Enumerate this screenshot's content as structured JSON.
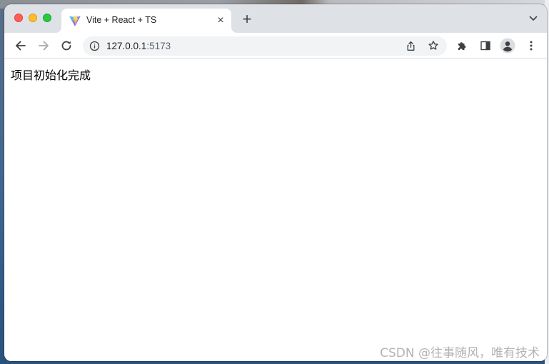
{
  "browser": {
    "tab": {
      "title": "Vite + React + TS"
    },
    "new_tab_label": "+",
    "close_tab_label": "×",
    "address_bar": {
      "host": "127.0.0.1",
      "port": ":5173"
    }
  },
  "page": {
    "body_text": "项目初始化完成"
  },
  "watermark": "CSDN @往事随风，唯有技术",
  "icons": {
    "back": "arrow-left-icon",
    "forward": "arrow-right-icon",
    "reload": "reload-icon",
    "info": "info-icon",
    "share": "share-icon",
    "bookmark": "star-icon",
    "extensions": "puzzle-icon",
    "side_panel": "side-panel-icon",
    "profile": "avatar-icon",
    "menu": "kebab-menu-icon",
    "tab_search": "chevron-down-icon",
    "favicon": "vite-logo-icon"
  },
  "colors": {
    "tabstrip": "#dee1e6",
    "omnibox": "#f1f3f4",
    "close_light": "#fe5f57",
    "minimize_light": "#febc2e",
    "maximize_light": "#28c840",
    "watermark": "#b3b3b3"
  }
}
